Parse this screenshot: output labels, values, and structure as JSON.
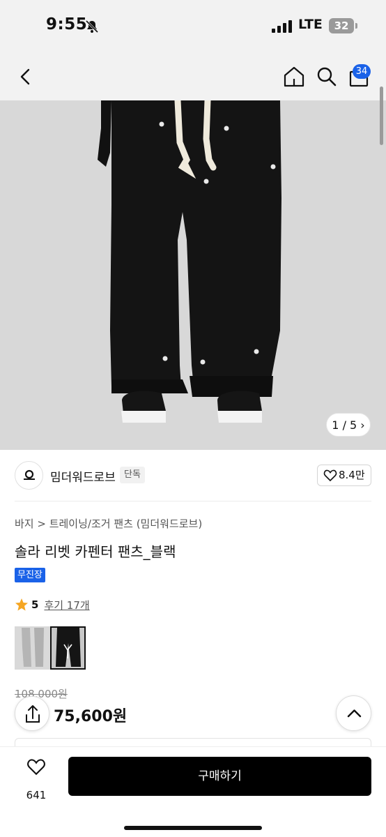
{
  "status": {
    "time": "9:55",
    "network": "LTE",
    "battery": "32"
  },
  "nav": {
    "cart_count": "34"
  },
  "gallery": {
    "counter": "1 / 5"
  },
  "brand": {
    "name": "밈더워드로브",
    "tag": "단독",
    "likes": "8.4만"
  },
  "product": {
    "breadcrumb": "바지 > 트레이닝/조거 팬츠 (밈더워드로브)",
    "title": "솔라 리벳 카펜터 팬츠_블랙",
    "badge": "무진장",
    "rating": "5",
    "reviews": "후기 17개",
    "original_price": "108,000원",
    "sale_price": "75,600원"
  },
  "bottom": {
    "wish_count": "641",
    "buy_label": "구매하기"
  },
  "colors": {
    "accent": "#1a62e8",
    "star": "#f5a623"
  }
}
